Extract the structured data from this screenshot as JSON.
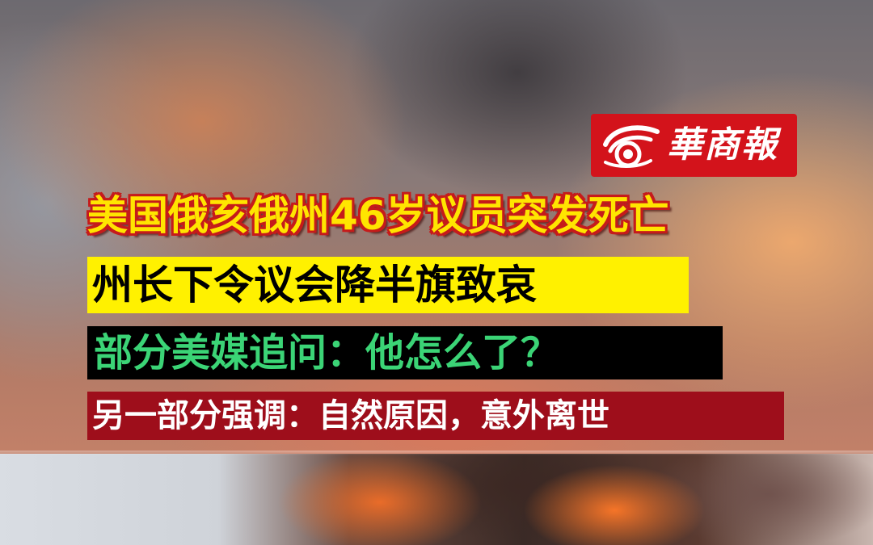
{
  "brand": {
    "logo_icon": "rooster-icon",
    "logo_text": "華商報",
    "logo_color": "#d3131b"
  },
  "headline": {
    "line1": "美国俄亥俄州46岁议员突发死亡",
    "line2": "州长下令议会降半旗致哀",
    "line3": "部分美媒追问：他怎么了？",
    "line4": "另一部分强调：自然原因，意外离世"
  },
  "colors": {
    "yellow": "#ffe500",
    "highlight_yellow": "#fff100",
    "green_text": "#3bd476",
    "dark_red": "#9e0e1b",
    "outline_red": "#c51b1b"
  }
}
